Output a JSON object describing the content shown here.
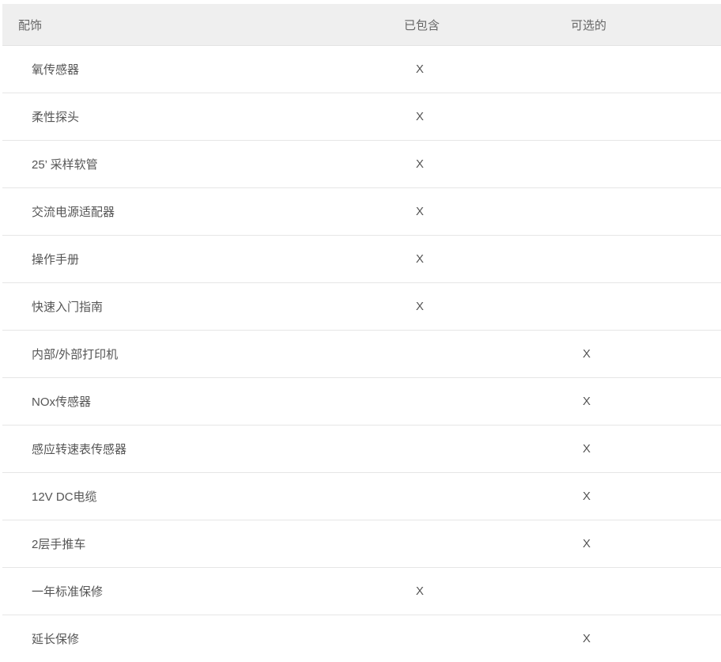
{
  "headers": {
    "accessory": "配饰",
    "included": "已包含",
    "optional": "可选的"
  },
  "rows": [
    {
      "name": "氧传感器",
      "included": "X",
      "optional": ""
    },
    {
      "name": "柔性探头",
      "included": "X",
      "optional": ""
    },
    {
      "name": "25’ 采样软管",
      "included": "X",
      "optional": ""
    },
    {
      "name": "交流电源适配器",
      "included": "X",
      "optional": ""
    },
    {
      "name": "操作手册",
      "included": "X",
      "optional": ""
    },
    {
      "name": "快速入门指南",
      "included": "X",
      "optional": ""
    },
    {
      "name": "内部/外部打印机",
      "included": "",
      "optional": "X"
    },
    {
      "name": "NOx传感器",
      "included": "",
      "optional": "X"
    },
    {
      "name": "感应转速表传感器",
      "included": "",
      "optional": "X"
    },
    {
      "name": "12V DC电缆",
      "included": "",
      "optional": "X"
    },
    {
      "name": "2层手推车",
      "included": "",
      "optional": "X"
    },
    {
      "name": "一年标准保修",
      "included": "X",
      "optional": ""
    },
    {
      "name": "延长保修",
      "included": "",
      "optional": "X"
    }
  ]
}
